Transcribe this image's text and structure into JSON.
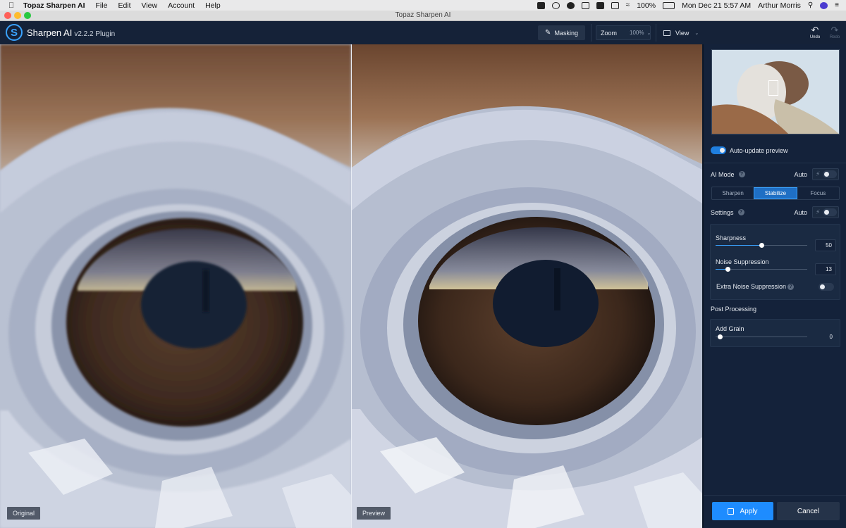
{
  "menubar": {
    "app_name": "Topaz Sharpen AI",
    "menus": [
      "File",
      "Edit",
      "View",
      "Account",
      "Help"
    ],
    "battery": "100%",
    "datetime": "Mon Dec 21  5:57 AM",
    "user": "Arthur Morris"
  },
  "window": {
    "title": "Topaz Sharpen AI"
  },
  "header": {
    "brand": "Sharpen AI",
    "version": "v2.2.2 Plugin",
    "masking_label": "Masking",
    "zoom_label": "Zoom",
    "zoom_value": "100%",
    "view_label": "View",
    "undo_label": "Undo",
    "redo_label": "Redo"
  },
  "panes": {
    "left_label": "Original",
    "right_label": "Preview"
  },
  "sidebar": {
    "auto_update_label": "Auto-update preview",
    "auto_update_on": true,
    "ai_mode_label": "AI Mode",
    "auto_label": "Auto",
    "modes": [
      "Sharpen",
      "Stabilize",
      "Focus"
    ],
    "active_mode": "Stabilize",
    "settings_label": "Settings",
    "sharpness_label": "Sharpness",
    "sharpness_value": 50,
    "noise_label": "Noise Suppression",
    "noise_value": 13,
    "extra_noise_label": "Extra Noise Suppression",
    "post_processing_label": "Post Processing",
    "add_grain_label": "Add Grain",
    "add_grain_value": 0,
    "apply_label": "Apply",
    "cancel_label": "Cancel"
  },
  "colors": {
    "accent": "#1e8cff",
    "sidebar_bg": "#14223a",
    "header_bg": "#152238"
  }
}
